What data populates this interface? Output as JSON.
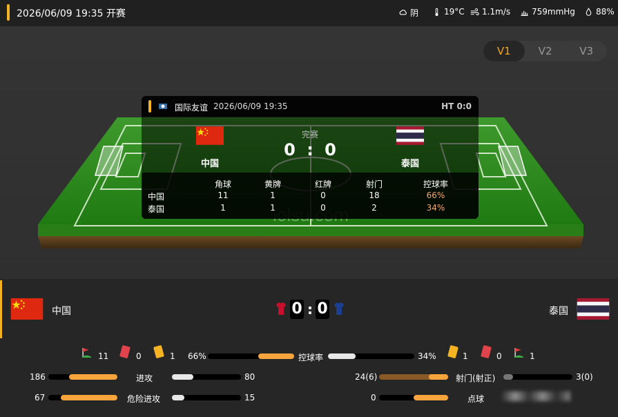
{
  "header": {
    "title": "2026/06/09 19:35 开赛",
    "weather": "阴",
    "temperature": "19°C",
    "wind": "1.1m/s",
    "pressure": "759mmHg",
    "humidity": "88%"
  },
  "view_tabs": [
    "V1",
    "V2",
    "V3"
  ],
  "active_tab": "V1",
  "pitch_watermark": "lolsu.com",
  "card": {
    "league": "国际友谊",
    "datetime": "2026/06/09 19:35",
    "ht": "HT 0:0",
    "status": "完赛",
    "home_name": "中国",
    "away_name": "泰国",
    "home_score": "0",
    "colon": ":",
    "away_score": "0",
    "stat_headers": [
      "角球",
      "黄牌",
      "红牌",
      "射门",
      "控球率"
    ],
    "rows": [
      {
        "team": "中国",
        "values": [
          "11",
          "1",
          "0",
          "18",
          "66%"
        ]
      },
      {
        "team": "泰国",
        "values": [
          "1",
          "1",
          "0",
          "2",
          "34%"
        ]
      }
    ]
  },
  "summary": {
    "home_name": "中国",
    "away_name": "泰国",
    "home_score": "0",
    "away_score": "0",
    "colon": ":",
    "home_corners": "11",
    "home_red": "0",
    "home_yellow": "1",
    "away_yellow": "1",
    "away_red": "0",
    "away_corners": "1",
    "possession_label": "控球率",
    "home_possession": "66%",
    "away_possession": "34%",
    "possession_home_fraction": 0.66
  },
  "bars": {
    "attack": {
      "label": "进攻",
      "home": "186",
      "away": "80"
    },
    "dangerous": {
      "label": "危险进攻",
      "home": "67",
      "away": "15"
    },
    "shots": {
      "label": "射门(射正)",
      "home": "24(6)",
      "away": "3(0)"
    },
    "penalty": {
      "label": "点球",
      "home": "0",
      "away": ""
    }
  },
  "colors": {
    "accent": "#f5b324",
    "bar_home": "#f7a43d",
    "bar_away": "#e8e8e8",
    "possession_text": "#f7a86b",
    "pitch_green": "#2e8b1e"
  }
}
